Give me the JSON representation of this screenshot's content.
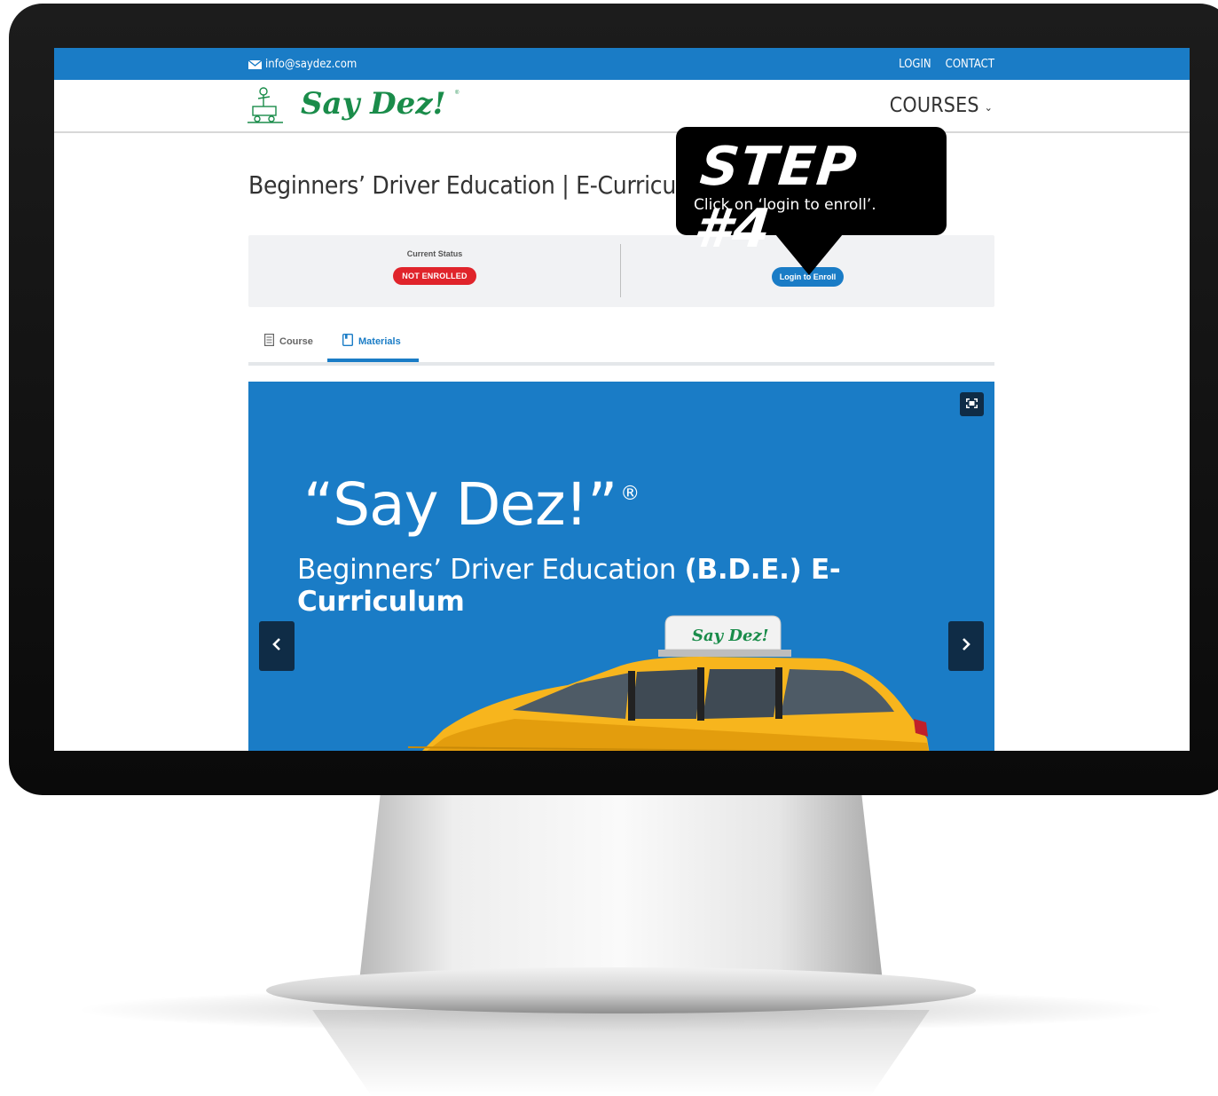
{
  "topbar": {
    "email": "info@saydez.com",
    "links": [
      "LOGIN",
      "CONTACT"
    ]
  },
  "header": {
    "logo_text": "Say Dez!",
    "courses_menu": "COURSES"
  },
  "page": {
    "title": "Beginners’ Driver Education | E-Curriculum"
  },
  "status": {
    "current_status_label": "Current Status",
    "current_status_value": "NOT ENROLLED",
    "login_button": "Login to Enroll"
  },
  "tabs": [
    {
      "label": "Course",
      "icon": "document-icon",
      "active": false
    },
    {
      "label": "Materials",
      "icon": "book-icon",
      "active": true
    }
  ],
  "carousel": {
    "title": "“Say Dez!”",
    "title_mark": "®",
    "subtitle_light": "Beginners’ Driver Education",
    "subtitle_bold": "(B.D.E.) E-Curriculum",
    "taxi_sign_text": "Say Dez!"
  },
  "callout": {
    "title": "STEP #4",
    "text": "Click on ‘login to enroll’."
  },
  "colors": {
    "brand_blue": "#1a7cc6",
    "dark_navy": "#0f2c46",
    "badge_red": "#e0242b",
    "logo_green": "#1a8c4a"
  }
}
